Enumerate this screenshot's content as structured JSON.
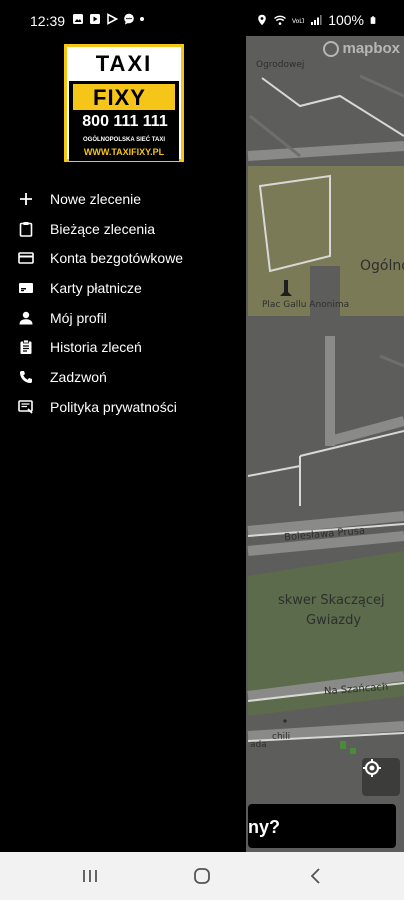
{
  "status_bar": {
    "time": "12:39",
    "battery": "100%",
    "left_icons": [
      "photo-icon",
      "video-icon",
      "play-icon",
      "message-icon"
    ],
    "right_icons": [
      "location-icon",
      "wifi-icon",
      "volte-icon",
      "signal-icon",
      "battery-icon"
    ]
  },
  "drawer": {
    "logo": {
      "title": "TAXI",
      "brand": "FIXY",
      "phone": "800 111 111",
      "tagline": "OGÓLNOPOLSKA SIEĆ TAXI",
      "website": "WWW.TAXIFIXY.PL"
    },
    "menu": [
      {
        "label": "Nowe zlecenie",
        "icon": "plus-icon"
      },
      {
        "label": "Bieżące zlecenia",
        "icon": "clipboard-icon"
      },
      {
        "label": "Konta bezgotówkowe",
        "icon": "card-icon"
      },
      {
        "label": "Karty płatnicze",
        "icon": "payment-card-icon"
      },
      {
        "label": "Mój profil",
        "icon": "person-icon"
      },
      {
        "label": "Historia zleceń",
        "icon": "history-icon"
      },
      {
        "label": "Zadzwoń",
        "icon": "phone-icon"
      },
      {
        "label": "Polityka prywatności",
        "icon": "policy-icon"
      }
    ]
  },
  "map": {
    "attribution": "mapbox",
    "labels": {
      "street_top": "Ogrodowej",
      "district": "Ogólno",
      "monument": "Plac Gallu Anonima",
      "street_prusa": "Bolesława Prusa",
      "park_line1": "skwer Skaczącej",
      "park_line2": "Gwiazdy",
      "street_szancach": "Na Szańcach",
      "chili": "chili",
      "ada": "ada"
    },
    "bottom_panel_text": "ny?"
  },
  "colors": {
    "accent": "#f5c518",
    "map_background": "#5d5e5b",
    "map_park": "#5b6b4b",
    "drawer_background": "#000000"
  }
}
